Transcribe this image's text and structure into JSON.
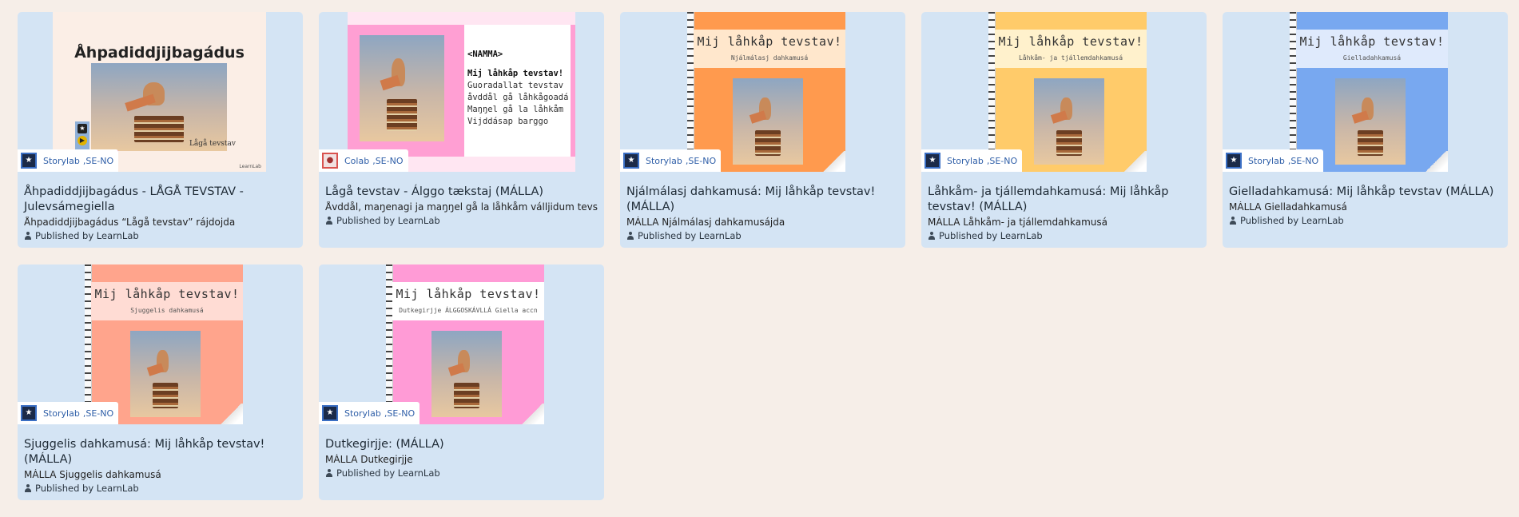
{
  "cards": [
    {
      "title": "Åhpadiddjijbagádus - LÅGÅ TEVSTAV - Julevsámegiella",
      "description": "Åhpadiddjijbagádus “Lågå tevstav” rájdojda",
      "published": "Published by LearnLab",
      "platform": "Storylab",
      "lang": ",SE-NO",
      "cover": {
        "type": "guide",
        "title": "Åhpadiddjijbagádus",
        "subtitle": "Lågå tevstav",
        "logo": "LearnLab",
        "bg": "#fbeee6"
      }
    },
    {
      "title": "Lågå tevstav - Álggo tækstaj (MÁLLA)",
      "description": "Åvddål, maŋenagi ja maŋŋel gå la låhkåm válljidum tevstav",
      "published": "Published by LearnLab",
      "platform": "Colab",
      "lang": ",SE-NO",
      "cover": {
        "type": "colab",
        "name_tag": "<NAMMA>",
        "heading": "Mij låhkåp tevstav!",
        "lines": [
          "Guoradallat tevstav",
          "åvddål gå låhkågoadá",
          "Maŋŋel gå la låhkåm",
          "Vijddásap barggo"
        ]
      }
    },
    {
      "title": "Njálmálasj dahkamusá: Mij låhkåp tevstav! (MÁLLA)",
      "description": "MÁLLA Njálmálasj dahkamusájda",
      "published": "Published by LearnLab",
      "platform": "Storylab",
      "lang": ",SE-NO",
      "cover": {
        "type": "book",
        "banner_title": "Mij låhkåp tevstav!",
        "banner_sub": "Njálmálasj dahkamusá",
        "bg": "#ff9a4e",
        "banner_bg": "#ffe7cc"
      }
    },
    {
      "title": "Låhkåm- ja tjállemdahkamusá: Mij låhkåp tevstav! (MÁLLA)",
      "description": "MÁLLA Låhkåm- ja tjállemdahkamusá",
      "published": "Published by LearnLab",
      "platform": "Storylab",
      "lang": ",SE-NO",
      "cover": {
        "type": "book",
        "banner_title": "Mij låhkåp tevstav!",
        "banner_sub": "Låhkåm- ja tjállemdahkamusá",
        "bg": "#ffcb6a",
        "banner_bg": "#fff1cc"
      }
    },
    {
      "title": "Gielladahkamusá: Mij låhkåp tevstav (MÁLLA)",
      "description": "MÁLLA Gielladahkamusá",
      "published": "Published by LearnLab",
      "platform": "Storylab",
      "lang": ",SE-NO",
      "cover": {
        "type": "book",
        "banner_title": "Mij låhkåp tevstav!",
        "banner_sub": "Gielladahkamusá",
        "bg": "#78a8f0",
        "banner_bg": "#dfeafc"
      }
    },
    {
      "title": "Sjuggelis dahkamusá: Mij låhkåp tevstav! (MÁLLA)",
      "description": "MÁLLA Sjuggelis dahkamusá",
      "published": "Published by LearnLab",
      "platform": "Storylab",
      "lang": ",SE-NO",
      "cover": {
        "type": "book",
        "banner_title": "Mij låhkåp tevstav!",
        "banner_sub": "Sjuggelis dahkamusá",
        "bg": "#ffa48c",
        "banner_bg": "#ffdcd4"
      }
    },
    {
      "title": "Dutkegirjje: (MÁLLA)",
      "description": "MÁLLA Dutkegirjje",
      "published": "Published by LearnLab",
      "platform": "Storylab",
      "lang": ",SE-NO",
      "cover": {
        "type": "book",
        "banner_title": "Mij låhkåp tevstav!",
        "banner_sub": "Dutkegirjje  ÁLGGOSKÁVLLÁ  Giella accn",
        "bg": "#ff9bd6",
        "banner_bg": "#ffffff"
      }
    }
  ]
}
